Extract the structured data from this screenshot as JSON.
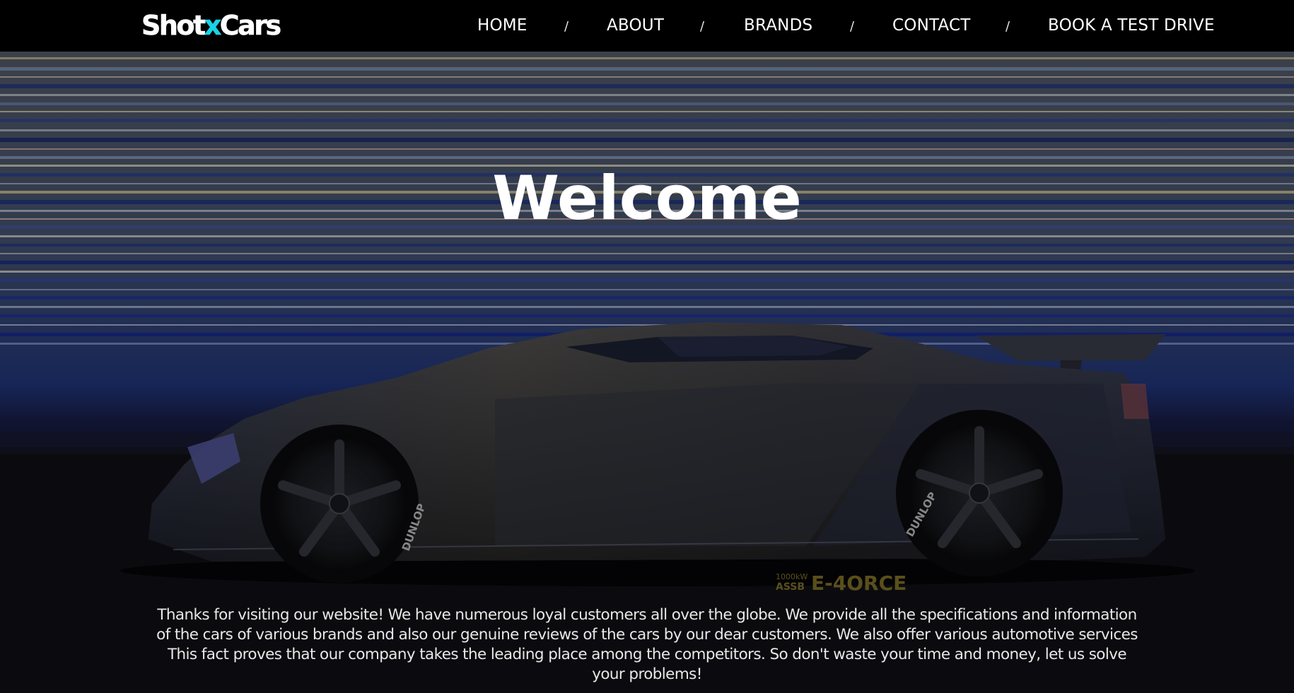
{
  "brand": {
    "logo_part1": "Shot",
    "logo_part2": "x",
    "logo_part3": "Cars",
    "accent_color": "#19d3e6"
  },
  "nav": {
    "items": [
      {
        "label": "HOME"
      },
      {
        "label": "ABOUT"
      },
      {
        "label": "BRANDS"
      },
      {
        "label": "CONTACT"
      },
      {
        "label": "BOOK A TEST DRIVE"
      }
    ],
    "separator": "/"
  },
  "hero": {
    "title": "Welcome",
    "description": "Thanks for visiting our website! We have numerous loyal customers all over the globe. We provide all the specifications and information of the cars of various brands and also our genuine reviews of the cars by our dear customers. We also offer various automotive services This fact proves that our company takes the leading place among the competitors. So don't waste your time and money, let us solve your problems!",
    "image": {
      "subject": "sports-car-photo",
      "tire_brand": "DUNLOP",
      "decal_line1": "1000kW",
      "decal_line2": "ASSB",
      "decal_main": "E-4ORCE"
    }
  }
}
